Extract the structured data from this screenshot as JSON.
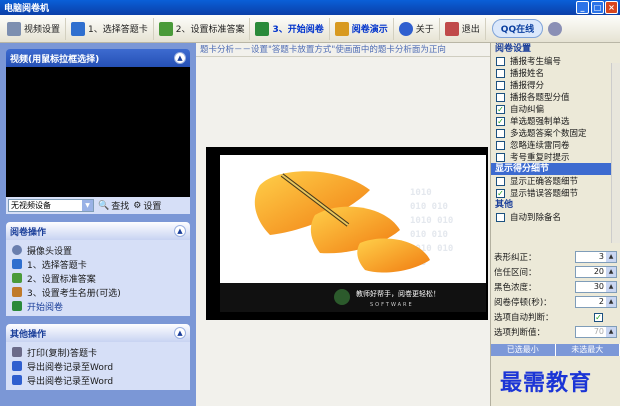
{
  "window": {
    "title": "电脑阅卷机"
  },
  "toolbar": {
    "items": [
      {
        "label": "视频设置",
        "icon": "gear-icon"
      },
      {
        "label": "1、选择答题卡",
        "icon": "card-icon"
      },
      {
        "label": "2、设置标准答案",
        "icon": "answer-icon"
      },
      {
        "label": "3、开始阅卷",
        "icon": "start-icon"
      },
      {
        "label": "阅卷演示",
        "icon": "demo-icon"
      },
      {
        "label": "关于",
        "icon": "help-icon"
      },
      {
        "label": "退出",
        "icon": "exit-icon"
      }
    ],
    "qq_label": "QQ在线"
  },
  "video_panel": {
    "title": "视频(用鼠标拉框选择)",
    "device_value": "无视频设备",
    "search_label": "查找",
    "settings_label": "设置"
  },
  "grading_panel": {
    "title": "阅卷操作",
    "items": [
      "摄像头设置",
      "1、选择答题卡",
      "2、设置标准答案",
      "3、设置考生名册(可选)",
      "开始阅卷"
    ]
  },
  "other_panel": {
    "title": "其他操作",
    "items": [
      "打印(复制)答题卡",
      "导出阅卷记录至Word",
      "导出阅卷记录至Word"
    ]
  },
  "center": {
    "hint": "题卡分析－－设置\"答题卡放置方式\"使画面中的题卡分析面为正向",
    "logo_caption": "教师好帮手，阅卷更轻松！",
    "logo_sub": "SOFTWARE"
  },
  "right_panel": {
    "group1": "阅卷设置",
    "checks1": [
      {
        "label": "播报考生编号",
        "checked": false
      },
      {
        "label": "播报姓名",
        "checked": false
      },
      {
        "label": "播报得分",
        "checked": false
      },
      {
        "label": "播报各题型分值",
        "checked": false
      },
      {
        "label": "自动纠偏",
        "checked": true
      },
      {
        "label": "单选题强制单选",
        "checked": true
      },
      {
        "label": "多选题答案个数固定",
        "checked": false
      },
      {
        "label": "忽略连续雷同卷",
        "checked": false
      },
      {
        "label": "考号重复时提示",
        "checked": false
      }
    ],
    "group2": "显示得分细节",
    "checks2": [
      {
        "label": "显示正确答题细节",
        "checked": false
      },
      {
        "label": "显示错误答题细节",
        "checked": true
      }
    ],
    "group3": "其他",
    "checks3": [
      {
        "label": "自动到除备名",
        "checked": false
      }
    ],
    "spins": [
      {
        "label": "表形纠正：",
        "value": "3"
      },
      {
        "label": "信任区间：",
        "value": "20"
      },
      {
        "label": "黑色浓度：",
        "value": "30"
      },
      {
        "label": "阅卷停顿(秒)：",
        "value": "2"
      }
    ],
    "auto_judge_label": "选项自动判断：",
    "judge_value_label": "选项判断值：",
    "judge_value": "70",
    "bottom_left": "已选最小",
    "bottom_right": "未选最大"
  },
  "watermark": "最需教育",
  "colors": {
    "accent": "#0a5fd8",
    "panel": "#7b97d6",
    "orange": "#f39a1a"
  }
}
